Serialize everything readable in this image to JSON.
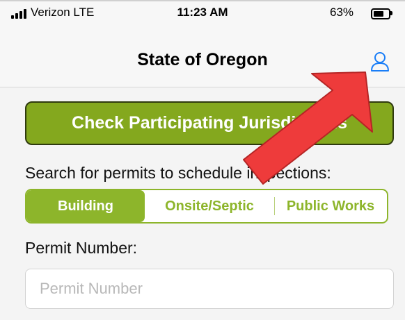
{
  "status_bar": {
    "carrier": "Verizon  LTE",
    "time": "11:23 AM",
    "battery": "63%"
  },
  "nav": {
    "title": "State of Oregon",
    "profile_icon": "person-outline-icon"
  },
  "main": {
    "check_button_label": "Check Participating Jurisdictions",
    "search_prompt": "Search for permits to schedule inspections:",
    "segments": [
      {
        "label": "Building",
        "selected": true
      },
      {
        "label": "Onsite/Septic",
        "selected": false
      },
      {
        "label": "Public Works",
        "selected": false
      }
    ],
    "permit_label": "Permit Number:",
    "permit_placeholder": "Permit Number",
    "permit_value": ""
  },
  "annotation": {
    "arrow_color": "#ee3b3b",
    "points_to": "profile-icon"
  },
  "colors": {
    "accent_green": "#8db52b",
    "button_green": "#84a81e",
    "ios_blue": "#1a7ef7"
  }
}
